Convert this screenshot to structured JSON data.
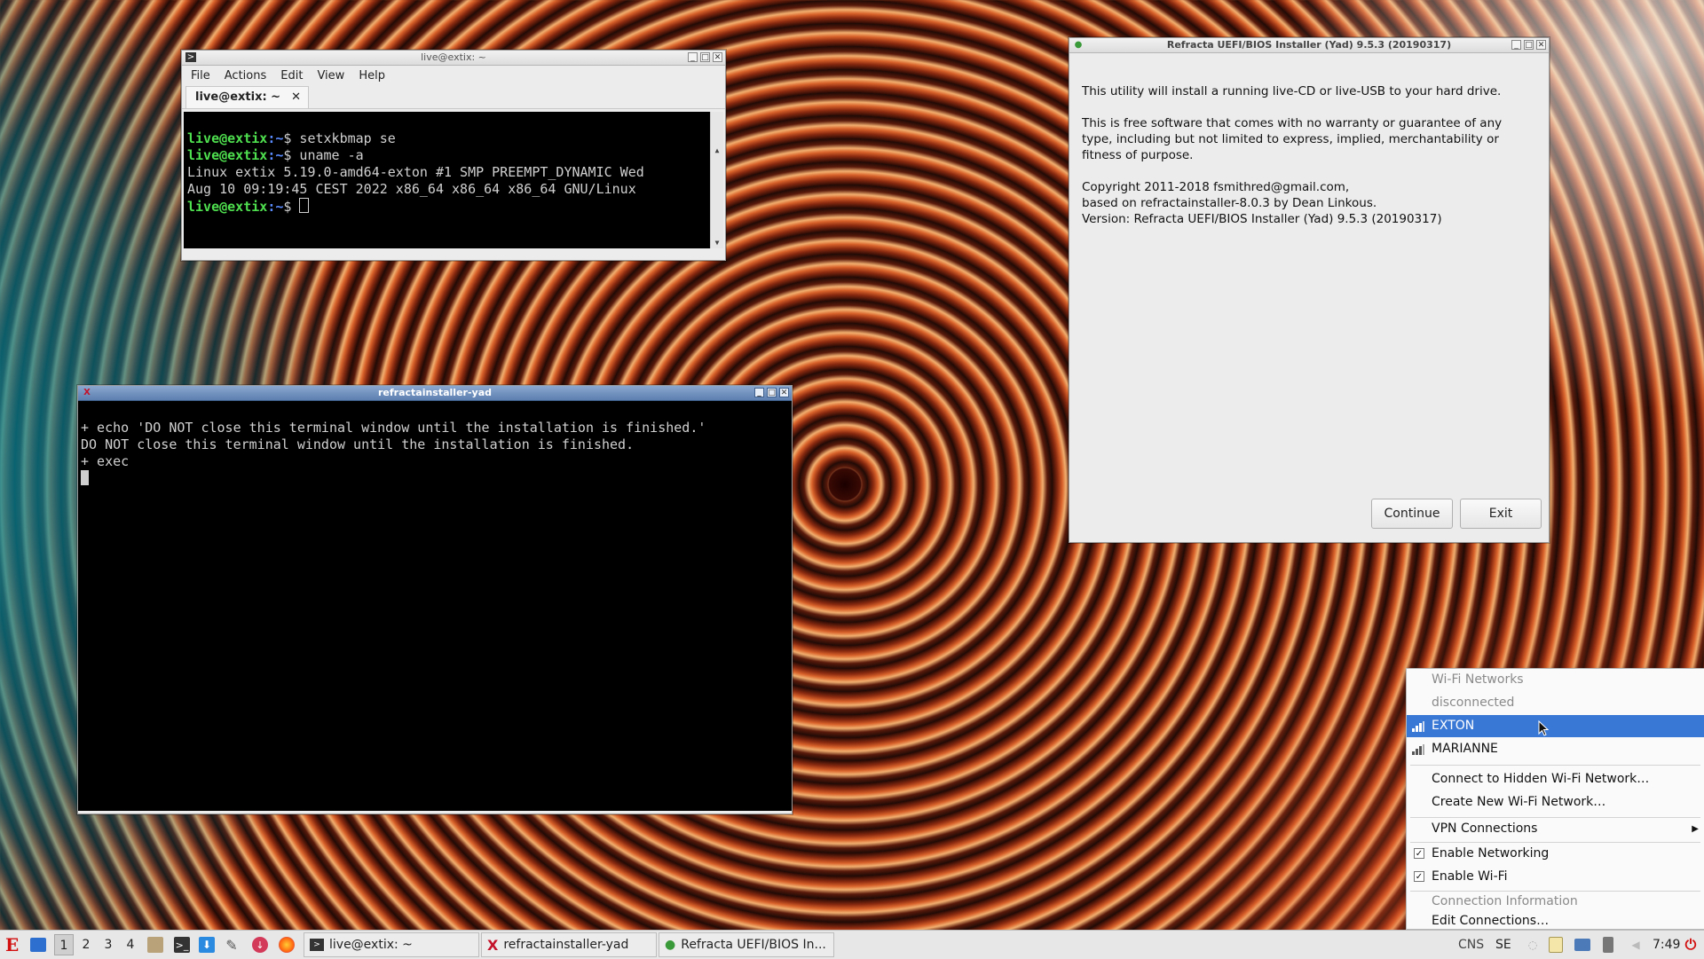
{
  "terminal1": {
    "title": "live@extix: ~",
    "menu": [
      "File",
      "Actions",
      "Edit",
      "View",
      "Help"
    ],
    "tab_label": "live@extix: ~",
    "tab_close": "✕",
    "lines": [
      {
        "user": "live@extix",
        "path": ":~",
        "cmd": "$ setxkbmap se"
      },
      {
        "user": "live@extix",
        "path": ":~",
        "cmd": "$ uname -a"
      },
      {
        "text": "Linux extix 5.19.0-amd64-exton #1 SMP PREEMPT_DYNAMIC Wed"
      },
      {
        "text": "Aug 10 09:19:45 CEST 2022 x86_64 x86_64 x86_64 GNU/Linux"
      },
      {
        "user": "live@extix",
        "path": ":~",
        "cmd": "$ "
      }
    ]
  },
  "terminal2": {
    "title": "refractainstaller-yad",
    "lines": [
      "+ echo 'DO NOT close this terminal window until the installation is finished.'",
      "DO NOT close this terminal window until the installation is finished.",
      "+ exec"
    ]
  },
  "installer": {
    "title": "Refracta UEFI/BIOS Installer (Yad) 9.5.3 (20190317)",
    "para1": "This utility will install a running live-CD or live-USB to your hard drive.",
    "para2": [
      "This is free software that comes with no warranty or guarantee of any",
      "type, including but not limited to express, implied, merchantability or",
      "fitness of purpose."
    ],
    "para3": [
      "Copyright 2011-2018 fsmithred@gmail.com,",
      "based on refractainstaller-8.0.3 by Dean Linkous.",
      "Version: Refracta UEFI/BIOS Installer (Yad) 9.5.3 (20190317)"
    ],
    "continue_label": "Continue",
    "exit_label": "Exit"
  },
  "network_menu": {
    "header": "Wi-Fi Networks",
    "status": "disconnected",
    "networks": [
      "EXTON",
      "MARIANNE"
    ],
    "hidden": "Connect to Hidden Wi-Fi Network…",
    "create": "Create New Wi-Fi Network…",
    "vpn": "VPN Connections",
    "enable_networking": "Enable Networking",
    "enable_wifi": "Enable Wi-Fi",
    "conn_info": "Connection Information",
    "edit": "Edit Connections…"
  },
  "taskbar": {
    "start": "E",
    "workspaces": [
      "1",
      "2",
      "3",
      "4"
    ],
    "tasks": [
      "live@extix: ~",
      "refractainstaller-yad",
      "Refracta UEFI/BIOS In..."
    ],
    "tray_text1": "CNS",
    "tray_text2": "SE",
    "clock": "7:49"
  },
  "colors": {
    "accent": "#3a78d6",
    "prompt_user": "#4fe04f",
    "prompt_path": "#5a8cff"
  }
}
